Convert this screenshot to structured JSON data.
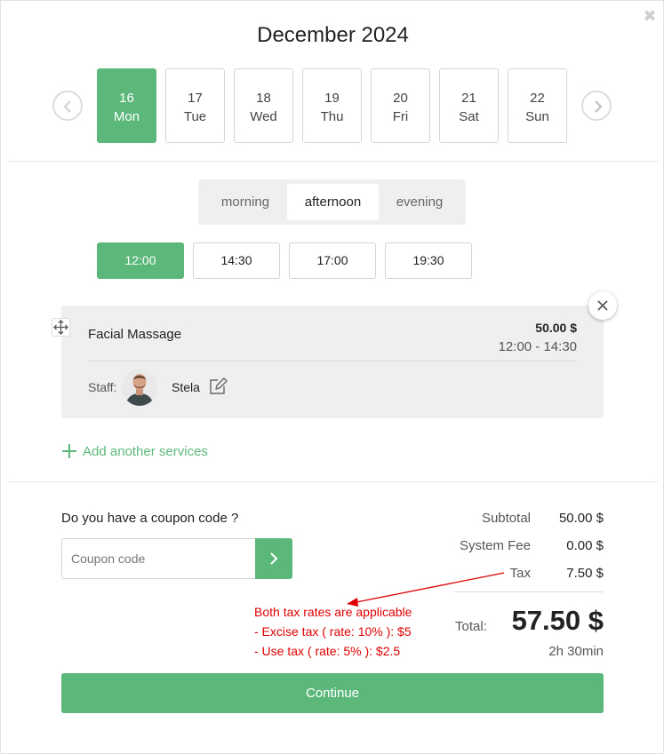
{
  "calendar": {
    "month_title": "December 2024",
    "days": [
      {
        "num": "16",
        "weekday": "Mon",
        "selected": true
      },
      {
        "num": "17",
        "weekday": "Tue",
        "selected": false
      },
      {
        "num": "18",
        "weekday": "Wed",
        "selected": false
      },
      {
        "num": "19",
        "weekday": "Thu",
        "selected": false
      },
      {
        "num": "20",
        "weekday": "Fri",
        "selected": false
      },
      {
        "num": "21",
        "weekday": "Sat",
        "selected": false
      },
      {
        "num": "22",
        "weekday": "Sun",
        "selected": false
      }
    ]
  },
  "periods": {
    "items": [
      "morning",
      "afternoon",
      "evening"
    ],
    "selected": "afternoon"
  },
  "times": {
    "items": [
      "12:00",
      "14:30",
      "17:00",
      "19:30"
    ],
    "selected": "12:00"
  },
  "service": {
    "name": "Facial Massage",
    "price": "50.00 $",
    "time_range": "12:00 - 14:30",
    "staff_label": "Staff:",
    "staff_name": "Stela"
  },
  "add_service_label": "Add another services",
  "coupon": {
    "question": "Do you have a coupon code ?",
    "placeholder": "Coupon code",
    "value": ""
  },
  "summary": {
    "subtotal_label": "Subtotal",
    "subtotal_value": "50.00 $",
    "fee_label": "System Fee",
    "fee_value": "0.00 $",
    "tax_label": "Tax",
    "tax_value": "7.50 $",
    "total_label": "Total:",
    "total_value": "57.50 $",
    "duration": "2h 30min"
  },
  "tax_note": {
    "line1": "Both tax rates are applicable",
    "line2": "- Excise tax ( rate: 10% ): $5",
    "line3": "- Use tax ( rate: 5% ): $2.5"
  },
  "continue_label": "Continue",
  "colors": {
    "accent": "#5cb87a",
    "annotation": "#e00000"
  }
}
